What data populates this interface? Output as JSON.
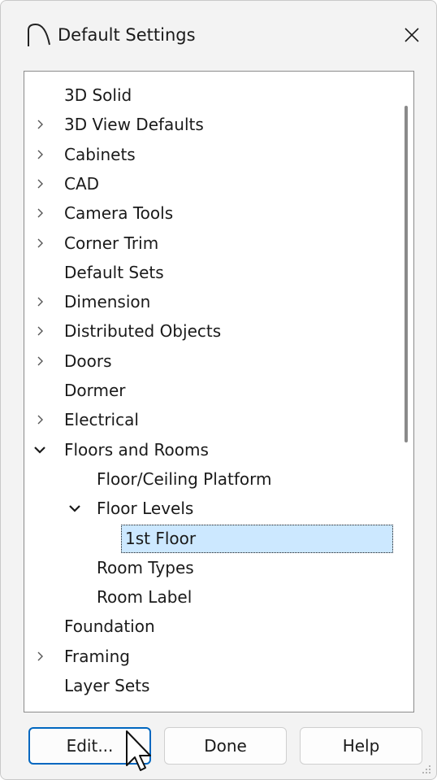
{
  "window": {
    "title": "Default Settings"
  },
  "tree": {
    "items": [
      {
        "label": "3D Solid",
        "indent": 0,
        "expander": "none"
      },
      {
        "label": "3D View Defaults",
        "indent": 0,
        "expander": "collapsed"
      },
      {
        "label": "Cabinets",
        "indent": 0,
        "expander": "collapsed"
      },
      {
        "label": "CAD",
        "indent": 0,
        "expander": "collapsed"
      },
      {
        "label": "Camera Tools",
        "indent": 0,
        "expander": "collapsed"
      },
      {
        "label": "Corner Trim",
        "indent": 0,
        "expander": "collapsed"
      },
      {
        "label": "Default Sets",
        "indent": 0,
        "expander": "none"
      },
      {
        "label": "Dimension",
        "indent": 0,
        "expander": "collapsed"
      },
      {
        "label": "Distributed Objects",
        "indent": 0,
        "expander": "collapsed"
      },
      {
        "label": "Doors",
        "indent": 0,
        "expander": "collapsed"
      },
      {
        "label": "Dormer",
        "indent": 0,
        "expander": "none"
      },
      {
        "label": "Electrical",
        "indent": 0,
        "expander": "collapsed"
      },
      {
        "label": "Floors and Rooms",
        "indent": 0,
        "expander": "expanded"
      },
      {
        "label": "Floor/Ceiling Platform",
        "indent": 1,
        "expander": "none"
      },
      {
        "label": "Floor Levels",
        "indent": 1,
        "expander": "expanded"
      },
      {
        "label": "1st Floor",
        "indent": 2,
        "expander": "none",
        "selected": true
      },
      {
        "label": "Room Types",
        "indent": 1,
        "expander": "none"
      },
      {
        "label": "Room Label",
        "indent": 1,
        "expander": "none"
      },
      {
        "label": "Foundation",
        "indent": 0,
        "expander": "none"
      },
      {
        "label": "Framing",
        "indent": 0,
        "expander": "collapsed"
      },
      {
        "label": "Layer Sets",
        "indent": 0,
        "expander": "none"
      }
    ]
  },
  "buttons": {
    "edit": "Edit...",
    "done": "Done",
    "help": "Help"
  },
  "colors": {
    "selection_bg": "#cce8ff",
    "default_button_border": "#0067c0",
    "window_bg": "#f3f3f3"
  },
  "icons": {
    "app": "arch-icon",
    "close": "close-icon",
    "collapsed": "chevron-right-icon",
    "expanded": "chevron-down-icon",
    "cursor": "mouse-pointer-icon"
  }
}
